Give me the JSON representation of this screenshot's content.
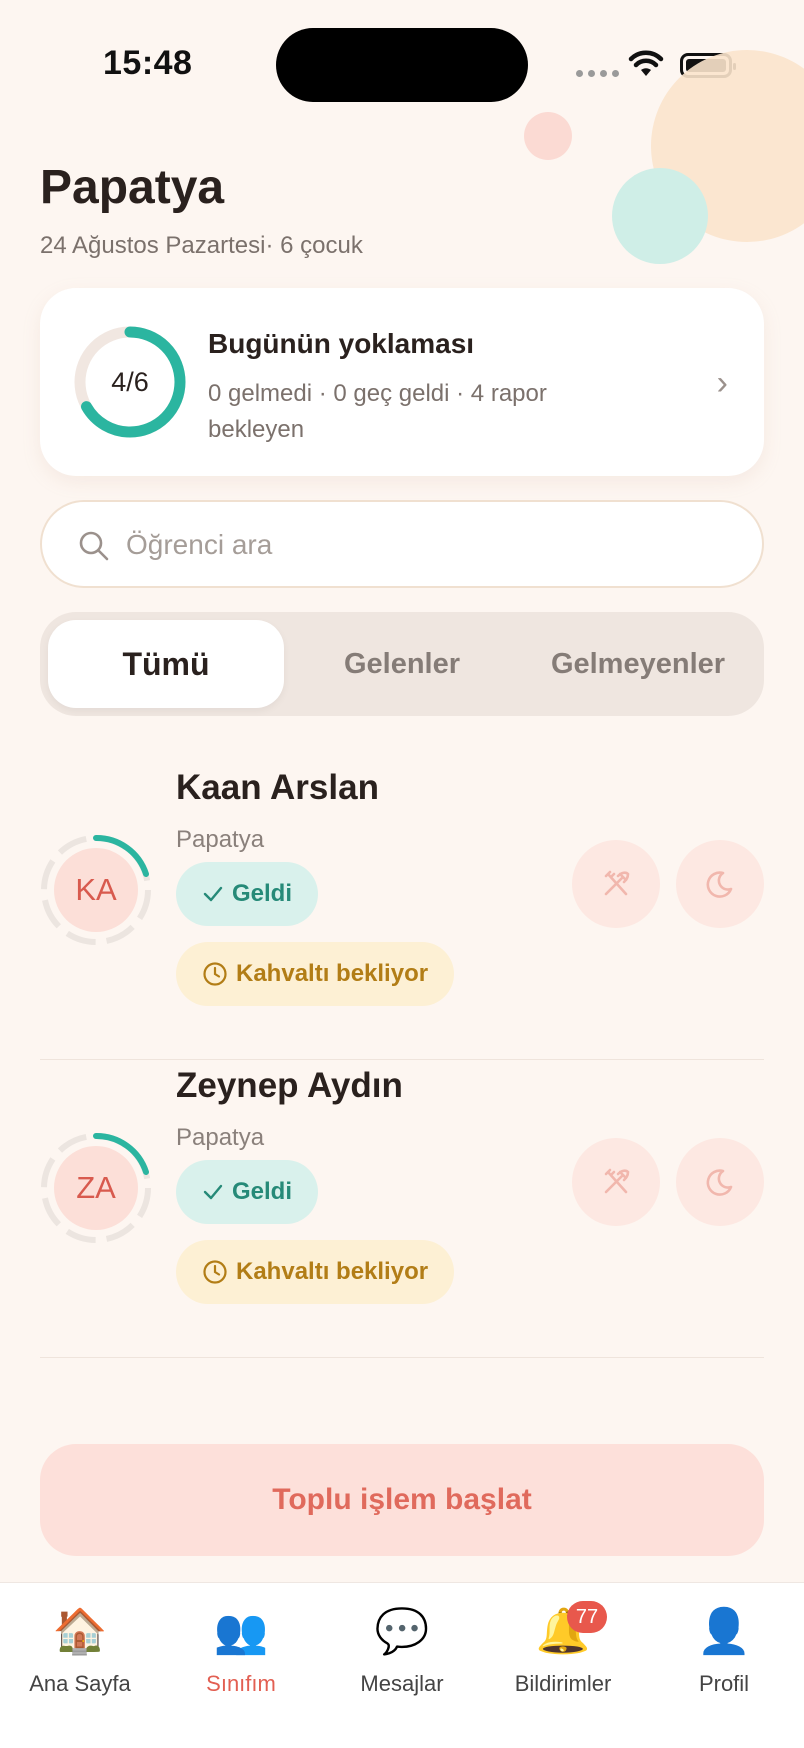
{
  "status": {
    "time": "15:48"
  },
  "header": {
    "title": "Papatya",
    "subtitle": "24 Ağustos Pazartesi· 6 çocuk"
  },
  "attendance": {
    "progress_label": "4/6",
    "progress_value": 0.6667,
    "title": "Bugünün yoklaması",
    "description": "0 gelmedi · 0 geç geldi · 4 rapor bekleyen",
    "accent_color": "#2bb5a0"
  },
  "search": {
    "placeholder": "Öğrenci ara"
  },
  "segments": [
    {
      "label": "Tümü",
      "active": true
    },
    {
      "label": "Gelenler",
      "active": false
    },
    {
      "label": "Gelmeyenler",
      "active": false
    }
  ],
  "students": [
    {
      "initials": "KA",
      "name": "Kaan Arslan",
      "class": "Papatya",
      "status": "Geldi",
      "meal_status": "Kahvaltı bekliyor"
    },
    {
      "initials": "ZA",
      "name": "Zeynep Aydın",
      "class": "Papatya",
      "status": "Geldi",
      "meal_status": "Kahvaltı bekliyor"
    }
  ],
  "bulk_action": {
    "label": "Toplu işlem başlat"
  },
  "tabbar": {
    "items": [
      {
        "label": "Ana Sayfa",
        "icon": "house-icon",
        "active": false
      },
      {
        "label": "Sınıfım",
        "icon": "people-icon",
        "active": true
      },
      {
        "label": "Mesajlar",
        "icon": "speech-bubble-icon",
        "active": false
      },
      {
        "label": "Bildirimler",
        "icon": "bell-icon",
        "active": false,
        "badge": "77"
      },
      {
        "label": "Profil",
        "icon": "person-icon",
        "active": false
      }
    ]
  }
}
